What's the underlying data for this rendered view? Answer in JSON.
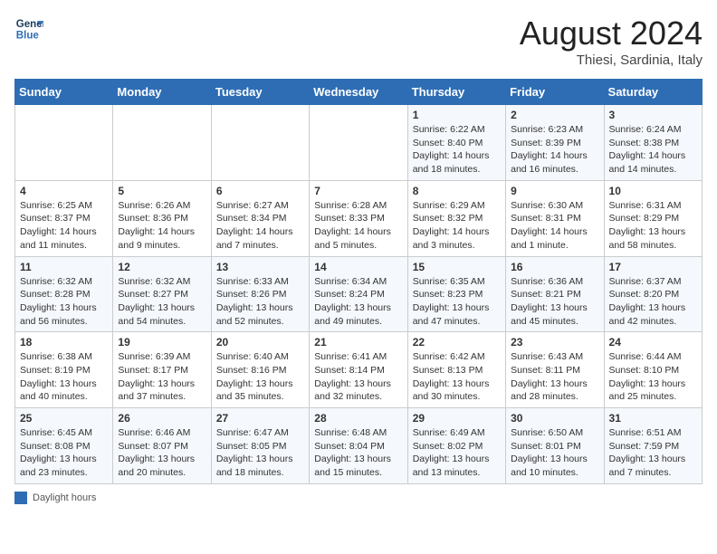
{
  "header": {
    "logo_line1": "General",
    "logo_line2": "Blue",
    "month_year": "August 2024",
    "location": "Thiesi, Sardinia, Italy"
  },
  "days_of_week": [
    "Sunday",
    "Monday",
    "Tuesday",
    "Wednesday",
    "Thursday",
    "Friday",
    "Saturday"
  ],
  "weeks": [
    [
      {
        "day": "",
        "content": ""
      },
      {
        "day": "",
        "content": ""
      },
      {
        "day": "",
        "content": ""
      },
      {
        "day": "",
        "content": ""
      },
      {
        "day": "1",
        "content": "Sunrise: 6:22 AM\nSunset: 8:40 PM\nDaylight: 14 hours and 18 minutes."
      },
      {
        "day": "2",
        "content": "Sunrise: 6:23 AM\nSunset: 8:39 PM\nDaylight: 14 hours and 16 minutes."
      },
      {
        "day": "3",
        "content": "Sunrise: 6:24 AM\nSunset: 8:38 PM\nDaylight: 14 hours and 14 minutes."
      }
    ],
    [
      {
        "day": "4",
        "content": "Sunrise: 6:25 AM\nSunset: 8:37 PM\nDaylight: 14 hours and 11 minutes."
      },
      {
        "day": "5",
        "content": "Sunrise: 6:26 AM\nSunset: 8:36 PM\nDaylight: 14 hours and 9 minutes."
      },
      {
        "day": "6",
        "content": "Sunrise: 6:27 AM\nSunset: 8:34 PM\nDaylight: 14 hours and 7 minutes."
      },
      {
        "day": "7",
        "content": "Sunrise: 6:28 AM\nSunset: 8:33 PM\nDaylight: 14 hours and 5 minutes."
      },
      {
        "day": "8",
        "content": "Sunrise: 6:29 AM\nSunset: 8:32 PM\nDaylight: 14 hours and 3 minutes."
      },
      {
        "day": "9",
        "content": "Sunrise: 6:30 AM\nSunset: 8:31 PM\nDaylight: 14 hours and 1 minute."
      },
      {
        "day": "10",
        "content": "Sunrise: 6:31 AM\nSunset: 8:29 PM\nDaylight: 13 hours and 58 minutes."
      }
    ],
    [
      {
        "day": "11",
        "content": "Sunrise: 6:32 AM\nSunset: 8:28 PM\nDaylight: 13 hours and 56 minutes."
      },
      {
        "day": "12",
        "content": "Sunrise: 6:32 AM\nSunset: 8:27 PM\nDaylight: 13 hours and 54 minutes."
      },
      {
        "day": "13",
        "content": "Sunrise: 6:33 AM\nSunset: 8:26 PM\nDaylight: 13 hours and 52 minutes."
      },
      {
        "day": "14",
        "content": "Sunrise: 6:34 AM\nSunset: 8:24 PM\nDaylight: 13 hours and 49 minutes."
      },
      {
        "day": "15",
        "content": "Sunrise: 6:35 AM\nSunset: 8:23 PM\nDaylight: 13 hours and 47 minutes."
      },
      {
        "day": "16",
        "content": "Sunrise: 6:36 AM\nSunset: 8:21 PM\nDaylight: 13 hours and 45 minutes."
      },
      {
        "day": "17",
        "content": "Sunrise: 6:37 AM\nSunset: 8:20 PM\nDaylight: 13 hours and 42 minutes."
      }
    ],
    [
      {
        "day": "18",
        "content": "Sunrise: 6:38 AM\nSunset: 8:19 PM\nDaylight: 13 hours and 40 minutes."
      },
      {
        "day": "19",
        "content": "Sunrise: 6:39 AM\nSunset: 8:17 PM\nDaylight: 13 hours and 37 minutes."
      },
      {
        "day": "20",
        "content": "Sunrise: 6:40 AM\nSunset: 8:16 PM\nDaylight: 13 hours and 35 minutes."
      },
      {
        "day": "21",
        "content": "Sunrise: 6:41 AM\nSunset: 8:14 PM\nDaylight: 13 hours and 32 minutes."
      },
      {
        "day": "22",
        "content": "Sunrise: 6:42 AM\nSunset: 8:13 PM\nDaylight: 13 hours and 30 minutes."
      },
      {
        "day": "23",
        "content": "Sunrise: 6:43 AM\nSunset: 8:11 PM\nDaylight: 13 hours and 28 minutes."
      },
      {
        "day": "24",
        "content": "Sunrise: 6:44 AM\nSunset: 8:10 PM\nDaylight: 13 hours and 25 minutes."
      }
    ],
    [
      {
        "day": "25",
        "content": "Sunrise: 6:45 AM\nSunset: 8:08 PM\nDaylight: 13 hours and 23 minutes."
      },
      {
        "day": "26",
        "content": "Sunrise: 6:46 AM\nSunset: 8:07 PM\nDaylight: 13 hours and 20 minutes."
      },
      {
        "day": "27",
        "content": "Sunrise: 6:47 AM\nSunset: 8:05 PM\nDaylight: 13 hours and 18 minutes."
      },
      {
        "day": "28",
        "content": "Sunrise: 6:48 AM\nSunset: 8:04 PM\nDaylight: 13 hours and 15 minutes."
      },
      {
        "day": "29",
        "content": "Sunrise: 6:49 AM\nSunset: 8:02 PM\nDaylight: 13 hours and 13 minutes."
      },
      {
        "day": "30",
        "content": "Sunrise: 6:50 AM\nSunset: 8:01 PM\nDaylight: 13 hours and 10 minutes."
      },
      {
        "day": "31",
        "content": "Sunrise: 6:51 AM\nSunset: 7:59 PM\nDaylight: 13 hours and 7 minutes."
      }
    ]
  ],
  "footer": {
    "legend_label": "Daylight hours"
  }
}
